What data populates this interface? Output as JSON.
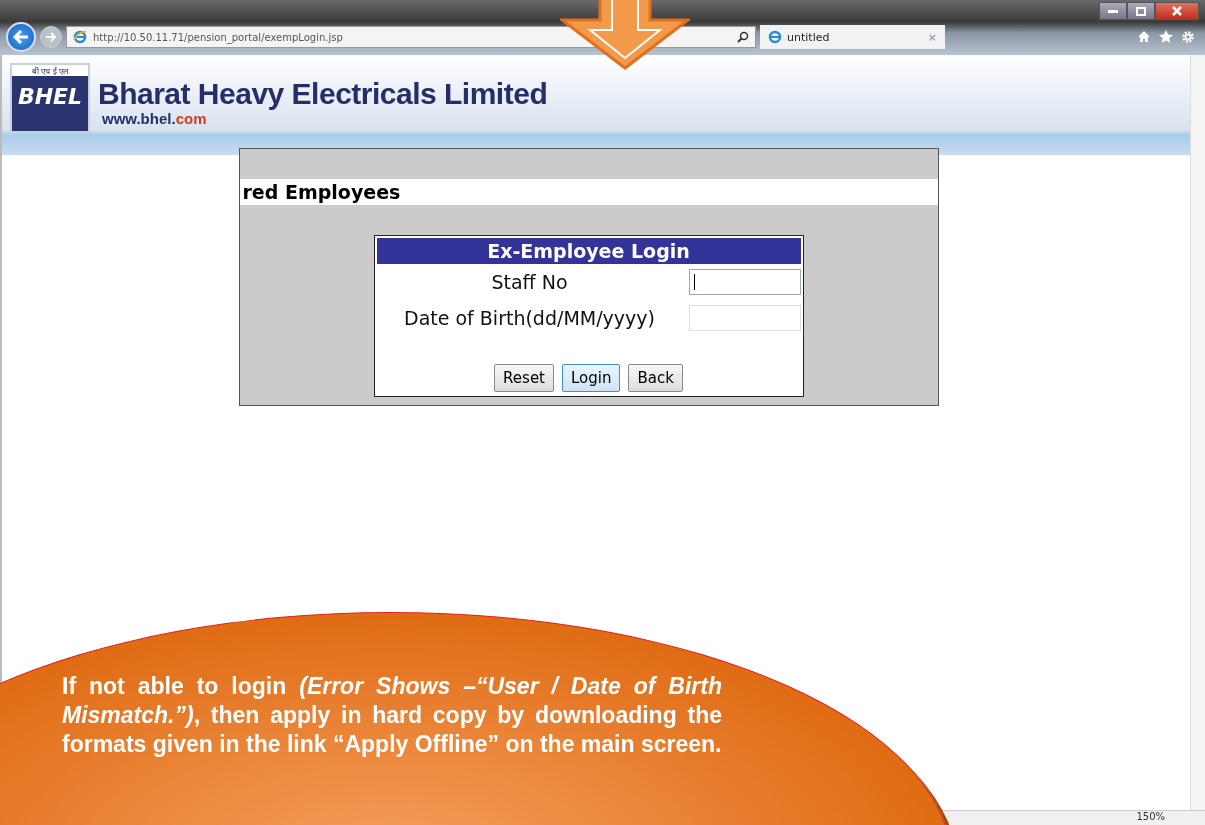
{
  "browser": {
    "address": "http://10.50.11.71/pension_portal/exempLogin.jsp",
    "tab": {
      "label": "untitled",
      "close": "×"
    },
    "zoom": "150%"
  },
  "header": {
    "logo_top": "बी एच ई एल",
    "logo_mark": "BHEL",
    "title": "Bharat Heavy Electricals Limited",
    "site": "www.bhel.",
    "site_tld": "com"
  },
  "panel": {
    "heading": "red Employees"
  },
  "login": {
    "title": "Ex-Employee Login",
    "fields": [
      {
        "label": "Staff No",
        "focused": true
      },
      {
        "label": "Date of Birth(dd/MM/yyyy)",
        "focused": false
      }
    ],
    "buttons": [
      {
        "label": "Reset",
        "selected": false
      },
      {
        "label": "Login",
        "selected": true
      },
      {
        "label": "Back",
        "selected": false
      }
    ]
  },
  "callout": {
    "text": "If not able to login *(Error Shows –“User / Date of Birth Mismatch.”)*, then apply in hard copy by downloading the formats given in the link “Apply Offline” on the main screen."
  }
}
